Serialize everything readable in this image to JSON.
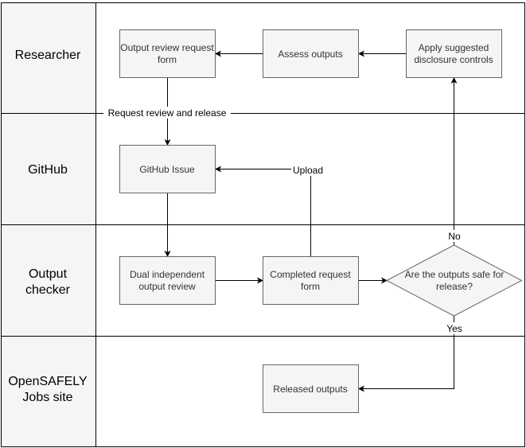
{
  "lanes": [
    {
      "label_lines": [
        "Researcher"
      ]
    },
    {
      "label_lines": [
        "GitHub"
      ]
    },
    {
      "label_lines": [
        "Output",
        "checker"
      ]
    },
    {
      "label_lines": [
        "OpenSAFELY",
        "Jobs site"
      ]
    }
  ],
  "nodes": {
    "review_form": {
      "lines": [
        "Output review request",
        "form"
      ]
    },
    "assess": {
      "lines": [
        "Assess outputs"
      ]
    },
    "apply_controls": {
      "lines": [
        "Apply suggested",
        "disclosure controls"
      ]
    },
    "github_issue": {
      "lines": [
        "GitHub Issue"
      ]
    },
    "dual_review": {
      "lines": [
        "Dual independent",
        "output review"
      ]
    },
    "completed_form": {
      "lines": [
        "Completed request",
        "form"
      ]
    },
    "decision": {
      "lines": [
        "Are the outputs safe for",
        "release?"
      ]
    },
    "released": {
      "lines": [
        "Released outputs"
      ]
    }
  },
  "edges": {
    "request_label": "Request review and release",
    "upload_label": "Upload",
    "no_label": "No",
    "yes_label": "Yes"
  },
  "colors": {
    "node_fill": "#f5f5f5",
    "node_stroke": "#666666",
    "lane_header_fill": "#f5f5f5"
  }
}
